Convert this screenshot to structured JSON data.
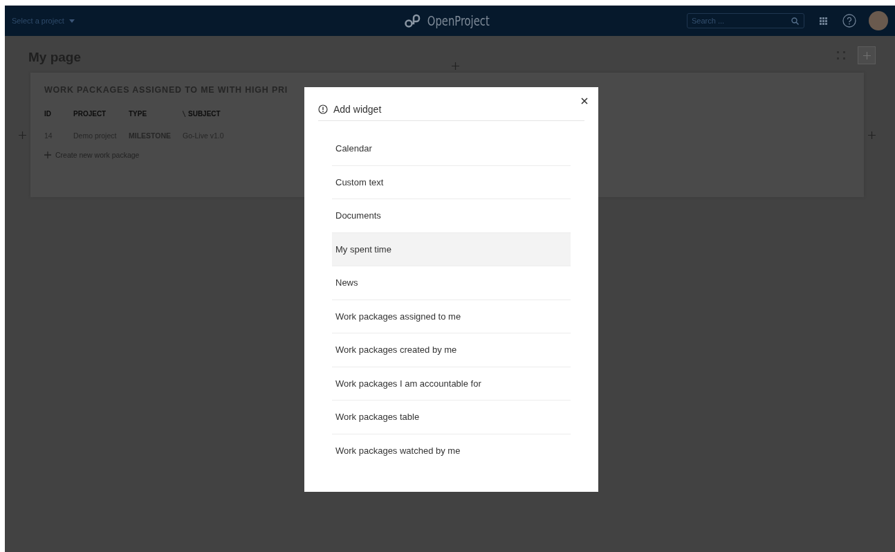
{
  "header": {
    "project_select": "Select a project",
    "logo": "OpenProject",
    "search": {
      "placeholder": "Search ..."
    }
  },
  "page": {
    "title": "My page"
  },
  "widget": {
    "title": "WORK PACKAGES ASSIGNED TO ME WITH HIGH PRI",
    "columns": [
      "ID",
      "PROJECT",
      "TYPE",
      "SUBJECT"
    ],
    "rows": [
      {
        "cells": [
          "14",
          "Demo project",
          "MILESTONE",
          "Go-Live v1.0"
        ]
      }
    ],
    "create_link": "Create new work package"
  },
  "dialog": {
    "title": "Add widget",
    "items": [
      {
        "label": "Calendar",
        "hovered": false
      },
      {
        "label": "Custom text",
        "hovered": false
      },
      {
        "label": "Documents",
        "hovered": false
      },
      {
        "label": "My spent time",
        "hovered": true
      },
      {
        "label": "News",
        "hovered": false
      },
      {
        "label": "Work packages assigned to me",
        "hovered": false
      },
      {
        "label": "Work packages created by me",
        "hovered": false
      },
      {
        "label": "Work packages I am accountable for",
        "hovered": false
      },
      {
        "label": "Work packages table",
        "hovered": false
      },
      {
        "label": "Work packages watched by me",
        "hovered": false
      }
    ]
  }
}
